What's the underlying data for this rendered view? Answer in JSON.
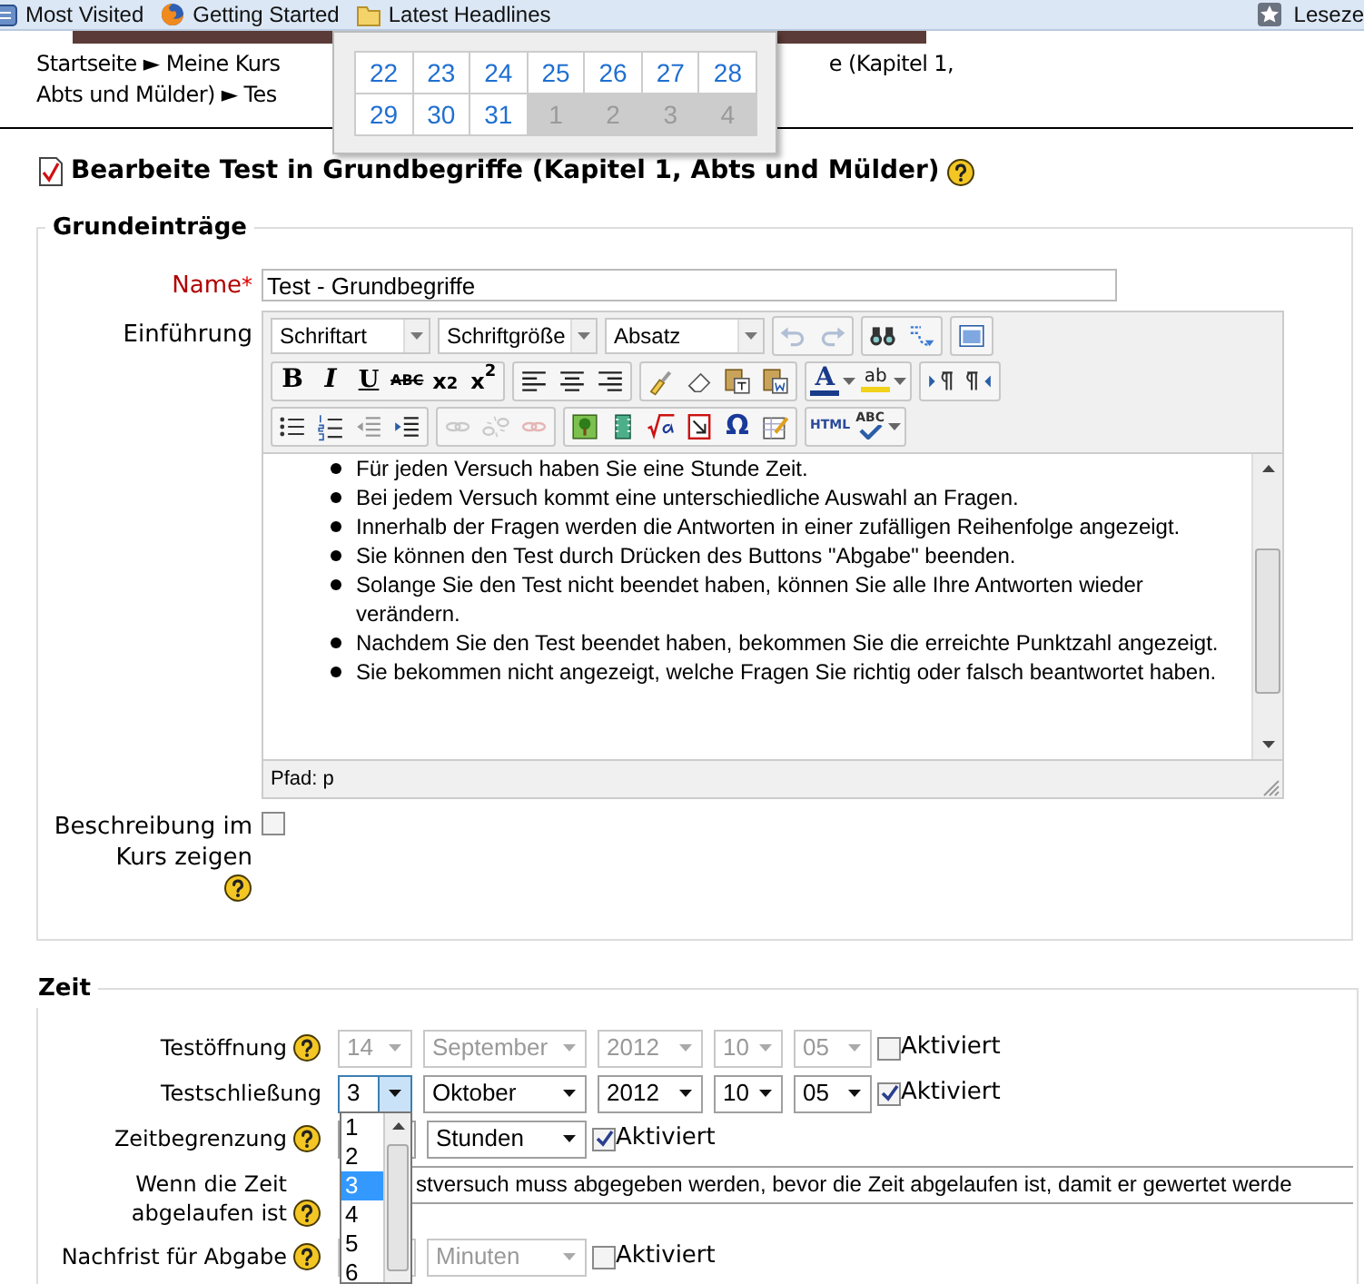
{
  "bookmarks_bar": {
    "items": [
      {
        "kind": "history",
        "label": "Most Visited"
      },
      {
        "kind": "browser",
        "label": "Getting Started"
      },
      {
        "kind": "folder",
        "label": "Latest Headlines"
      }
    ],
    "right_item": "Leseze"
  },
  "breadcrumb": {
    "line_1_left": "Startseite ► Meine Kurs",
    "line_1_right": "e (Kapitel 1,",
    "line_2": "Abts und Mülder) ► Tes"
  },
  "calendar_popup": {
    "weeks": [
      [
        {
          "day": "22",
          "other_month": false
        },
        {
          "day": "23",
          "other_month": false
        },
        {
          "day": "24",
          "other_month": false
        },
        {
          "day": "25",
          "other_month": false
        },
        {
          "day": "26",
          "other_month": false
        },
        {
          "day": "27",
          "other_month": false
        },
        {
          "day": "28",
          "other_month": false
        }
      ],
      [
        {
          "day": "29",
          "other_month": false
        },
        {
          "day": "30",
          "other_month": false
        },
        {
          "day": "31",
          "other_month": false
        },
        {
          "day": "1",
          "other_month": true
        },
        {
          "day": "2",
          "other_month": true
        },
        {
          "day": "3",
          "other_month": true
        },
        {
          "day": "4",
          "other_month": true
        }
      ]
    ]
  },
  "page_title": "Bearbeite Test in Grundbegriffe (Kapitel 1, Abts und Mülder)",
  "general_section": {
    "legend": "Grundeinträge",
    "name_field": {
      "label": "Name",
      "required_mark": "*",
      "value": "Test - Grundbegriffe"
    },
    "intro": {
      "label": "Einführung",
      "toolbar_rows": [
        [
          [
            {
              "kind": "select",
              "label": "Schriftart",
              "disabled": false
            },
            {
              "kind": "select",
              "label": "Schriftgröße",
              "disabled": false
            },
            {
              "kind": "select",
              "label": "Absatz",
              "disabled": false
            }
          ],
          [
            {
              "kind": "undo",
              "disabled": true
            },
            {
              "kind": "redo",
              "disabled": true
            }
          ],
          [
            {
              "kind": "find",
              "disabled": false
            },
            {
              "kind": "replace",
              "disabled": false
            }
          ],
          [
            {
              "kind": "fullscreen",
              "disabled": false
            }
          ]
        ],
        [
          [
            {
              "kind": "bold",
              "label": "B",
              "disabled": false
            },
            {
              "kind": "italic",
              "label": "I",
              "disabled": false
            },
            {
              "kind": "underline",
              "label": "U",
              "disabled": false
            },
            {
              "kind": "strike",
              "label": "ABC",
              "disabled": false
            },
            {
              "kind": "sub",
              "label": "x$_{2}$",
              "disabled": false
            },
            {
              "kind": "sup",
              "label": "x$^{2}$",
              "disabled": false
            }
          ],
          [
            {
              "kind": "alignleft",
              "disabled": false
            },
            {
              "kind": "aligncenter",
              "disabled": false
            },
            {
              "kind": "alignright",
              "disabled": false
            }
          ],
          [
            {
              "kind": "cleanup",
              "disabled": false
            },
            {
              "kind": "eraser",
              "disabled": false
            },
            {
              "kind": "pastetext",
              "disabled": false
            },
            {
              "kind": "pasteword",
              "disabled": false
            }
          ],
          [
            {
              "kind": "forecolor",
              "label": "A",
              "disabled": false
            },
            {
              "kind": "backcolor",
              "label": "ab",
              "disabled": false
            }
          ],
          [
            {
              "kind": "ltr",
              "disabled": false
            },
            {
              "kind": "rtl",
              "disabled": false
            }
          ]
        ],
        [
          [
            {
              "kind": "bullist",
              "disabled": false
            },
            {
              "kind": "numlist",
              "disabled": false
            },
            {
              "kind": "outdent",
              "disabled": false
            },
            {
              "kind": "indent",
              "disabled": false
            }
          ],
          [
            {
              "kind": "link",
              "disabled": true
            },
            {
              "kind": "unlink",
              "disabled": true
            },
            {
              "kind": "anchor",
              "disabled": true
            }
          ],
          [
            {
              "kind": "image",
              "disabled": false
            },
            {
              "kind": "media",
              "disabled": false
            },
            {
              "kind": "equation",
              "disabled": false
            },
            {
              "kind": "nolink",
              "disabled": false
            },
            {
              "kind": "symbol",
              "label": "Ω",
              "disabled": false
            },
            {
              "kind": "edit",
              "disabled": false
            }
          ],
          [
            {
              "kind": "html",
              "label": "HTML",
              "disabled": false
            },
            {
              "kind": "spell",
              "label": "ABC",
              "disabled": false
            }
          ]
        ]
      ],
      "content": [
        "Für jeden Versuch haben Sie eine Stunde Zeit.",
        "Bei jedem Versuch kommt eine unterschiedliche Auswahl an Fragen.",
        "Innerhalb der Fragen werden die Antworten in einer zufälligen Reihenfolge angezeigt.",
        "Sie können den Test durch Drücken des Buttons \"Abgabe\" beenden.",
        "Solange Sie den Test nicht beendet haben, können Sie alle Ihre Antworten wieder verändern.",
        "Nachdem Sie den Test beendet haben, bekommen Sie die erreichte Punktzahl angezeigt.",
        "Sie bekommen nicht angezeigt, welche Fragen Sie richtig oder falsch beantwortet haben."
      ],
      "path": "Pfad: p"
    },
    "show_description": {
      "label": "Beschreibung im Kurs zeigen",
      "help": true,
      "checked": false
    }
  },
  "timing_section": {
    "legend": "Zeit",
    "rows": [
      {
        "label": "Testöffnung",
        "help": true,
        "controls": [
          {
            "kind": "day",
            "value": "14",
            "disabled": true,
            "focused": false
          },
          {
            "kind": "month",
            "value": "September",
            "disabled": true,
            "focused": false
          },
          {
            "kind": "year",
            "value": "2012",
            "disabled": true,
            "focused": false
          },
          {
            "kind": "hour",
            "value": "10",
            "disabled": true,
            "focused": false
          },
          {
            "kind": "minute",
            "value": "05",
            "disabled": true,
            "focused": false
          }
        ],
        "enable": {
          "label": "Aktiviert",
          "checked": false
        }
      },
      {
        "label": "Testschließung",
        "help": false,
        "controls": [
          {
            "kind": "day",
            "value": "3",
            "disabled": false,
            "focused": true
          },
          {
            "kind": "month",
            "value": "Oktober",
            "disabled": false,
            "focused": false
          },
          {
            "kind": "year",
            "value": "2012",
            "disabled": false,
            "focused": false
          },
          {
            "kind": "hour",
            "value": "10",
            "disabled": false,
            "focused": false
          },
          {
            "kind": "minute",
            "value": "05",
            "disabled": false,
            "focused": false
          }
        ],
        "enable": {
          "label": "Aktiviert",
          "checked": true
        }
      },
      {
        "label": "Zeitbegrenzung",
        "help": true,
        "controls": [
          {
            "kind": "number",
            "disabled": false,
            "focused": false
          },
          {
            "kind": "unit",
            "value": "Stunden",
            "disabled": false,
            "focused": false
          }
        ],
        "enable": {
          "label": "Aktiviert",
          "checked": true
        }
      },
      {
        "label": "Wenn die Zeit abgelaufen ist",
        "help": true,
        "controls": [
          {
            "kind": "wide",
            "value": "stversuch muss abgegeben werden, bevor die Zeit abgelaufen ist, damit er gewertet werde",
            "disabled": false,
            "focused": false
          }
        ]
      },
      {
        "label": "Nachfrist für Abgabe",
        "help": true,
        "controls": [
          {
            "kind": "number",
            "disabled": true,
            "focused": false
          },
          {
            "kind": "unit",
            "value": "Minuten",
            "disabled": true,
            "focused": false
          }
        ],
        "enable": {
          "label": "Aktiviert",
          "checked": false
        }
      }
    ]
  },
  "dropdown_list": {
    "options": [
      {
        "label": "1",
        "selected": false
      },
      {
        "label": "2",
        "selected": false
      },
      {
        "label": "3",
        "selected": true
      },
      {
        "label": "4",
        "selected": false
      },
      {
        "label": "5",
        "selected": false
      },
      {
        "label": "6",
        "selected": false
      }
    ]
  }
}
